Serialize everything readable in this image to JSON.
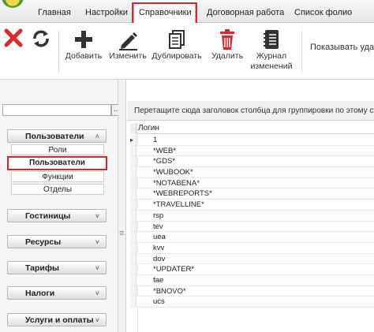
{
  "menu": {
    "tabs": [
      {
        "label": "Главная"
      },
      {
        "label": "Настройки"
      },
      {
        "label": "Справочники"
      },
      {
        "label": "Договорная работа"
      },
      {
        "label": "Список фолио"
      }
    ],
    "active_tab": "Справочники"
  },
  "ribbon": {
    "buttons": [
      {
        "label": "Добавить",
        "icon": "plus-icon"
      },
      {
        "label": "Изменить",
        "icon": "pencil-icon"
      },
      {
        "label": "Дублировать",
        "icon": "copy-icon"
      },
      {
        "label": "Удалить",
        "icon": "trash-icon"
      },
      {
        "label": "Журнал",
        "label2": "изменений",
        "icon": "journal-icon"
      }
    ],
    "big_icons": [
      "close-icon",
      "refresh-icon"
    ],
    "show_label": "Показывать уда",
    "colors": {
      "close": "#e0262b",
      "delete": "#e0262b",
      "icon": "#333333"
    }
  },
  "sidebar": {
    "search_placeholder": "",
    "search_button": "...",
    "groups": [
      {
        "label": "Пользователи",
        "expanded": true,
        "items": [
          {
            "label": "Роли"
          },
          {
            "label": "Пользователи"
          },
          {
            "label": "Функции"
          },
          {
            "label": "Отделы"
          }
        ]
      },
      {
        "label": "Гостиницы",
        "expanded": false
      },
      {
        "label": "Ресурсы",
        "expanded": false
      },
      {
        "label": "Тарифы",
        "expanded": false
      },
      {
        "label": "Налоги",
        "expanded": false
      },
      {
        "label": "Услуги и оплаты",
        "expanded": false
      }
    ],
    "active_item": "Пользователи"
  },
  "grid": {
    "group_hint": "Перетащите сюда заголовок столбца для группировки по этому стол",
    "columns": [
      "Логин"
    ],
    "rows": [
      "1",
      "*WEB*",
      "*GDS*",
      "*WUBOOK*",
      "*NOTABENA*",
      "*WEBREPORTS*",
      "*TRAVELLINE*",
      "rsp",
      "tev",
      "uea",
      "kvv",
      "dov",
      "*UPDATER*",
      "fae",
      "*BNOVO*",
      "ucs"
    ]
  },
  "colors": {
    "highlight": "#e0262b"
  }
}
